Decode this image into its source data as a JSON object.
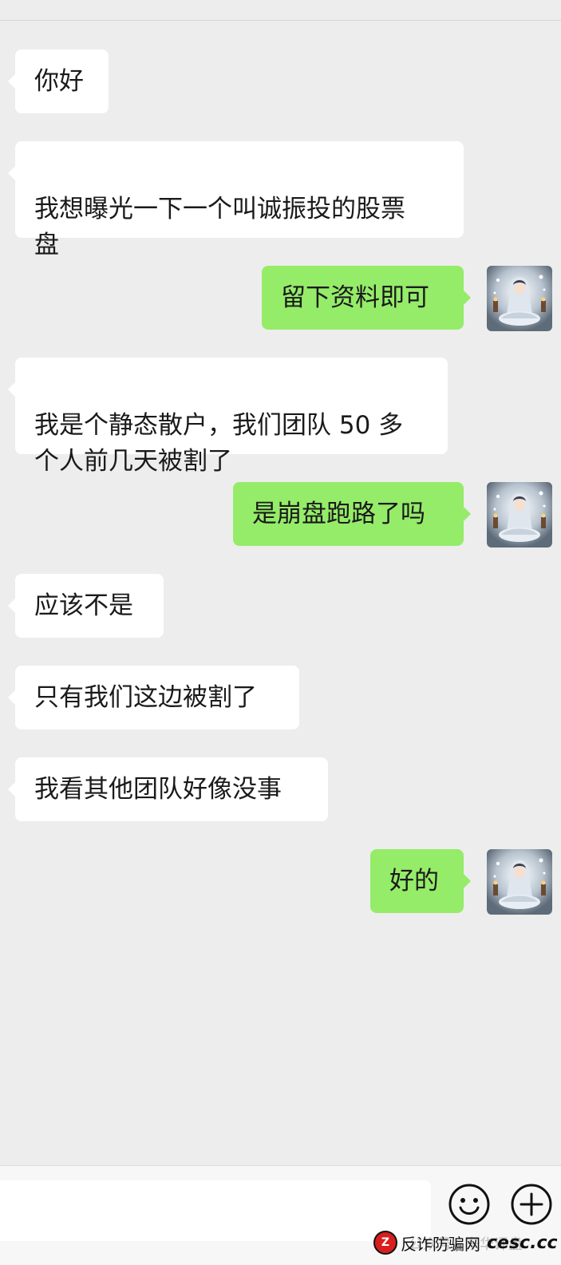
{
  "chat": {
    "messages": [
      {
        "side": "in",
        "text": "你好"
      },
      {
        "side": "in",
        "text": "我想曝光一下一个叫诚振投的股票\n盘"
      },
      {
        "side": "out",
        "text": "留下资料即可"
      },
      {
        "side": "in",
        "text": "我是个静态散户，我们团队 50 多\n个人前几天被割了"
      },
      {
        "side": "out",
        "text": "是崩盘跑路了吗"
      },
      {
        "side": "in",
        "text": "应该不是"
      },
      {
        "side": "in",
        "text": "只有我们这边被割了"
      },
      {
        "side": "in",
        "text": "我看其他团队好像没事"
      },
      {
        "side": "out",
        "text": "好的"
      }
    ]
  },
  "input_bar": {
    "placeholder": "",
    "emoji_icon": "smiley-icon",
    "plus_icon": "plus-icon",
    "watermark_text": "公众号 · 东华评盘"
  },
  "stamp": {
    "logo_letter": "Z",
    "cn_text": "反诈防骗网",
    "en_text": "cesc.cc"
  },
  "colors": {
    "background": "#ededed",
    "incoming_bubble": "#ffffff",
    "outgoing_bubble": "#95ec69"
  }
}
